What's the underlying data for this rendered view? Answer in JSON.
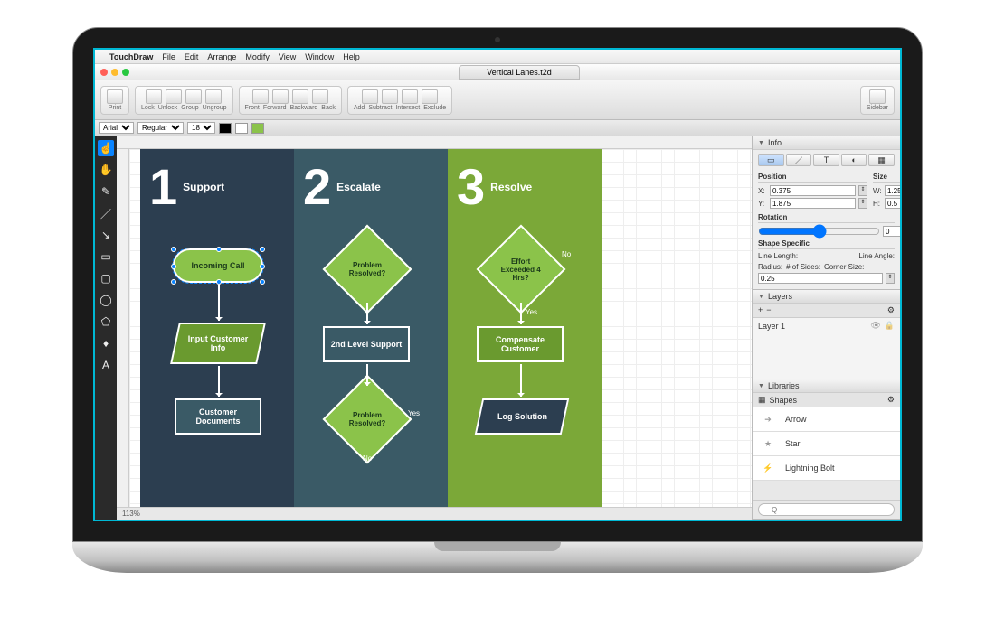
{
  "menubar": {
    "app": "TouchDraw",
    "items": [
      "File",
      "Edit",
      "Arrange",
      "Modify",
      "View",
      "Window",
      "Help"
    ]
  },
  "document": {
    "title": "Vertical Lanes.t2d"
  },
  "toolbar": {
    "print": "Print",
    "lock": "Lock",
    "unlock": "Unlock",
    "group": "Group",
    "ungroup": "Ungroup",
    "front": "Front",
    "forward": "Forward",
    "backward": "Backward",
    "back": "Back",
    "add": "Add",
    "subtract": "Subtract",
    "intersect": "Intersect",
    "exclude": "Exclude",
    "sidebar": "Sidebar"
  },
  "formatbar": {
    "font": "Arial",
    "weight": "Regular",
    "size": "18"
  },
  "status": {
    "zoom": "113%"
  },
  "lanes": [
    {
      "num": "1",
      "title": "Support"
    },
    {
      "num": "2",
      "title": "Escalate"
    },
    {
      "num": "3",
      "title": "Resolve"
    }
  ],
  "nodes": {
    "incoming": "Incoming Call",
    "problem1": "Problem Resolved?",
    "effort": "Effort Exceeded 4 Hrs?",
    "input": "Input Customer Info",
    "support2": "2nd Level Support",
    "compensate": "Compensate Customer",
    "docs": "Customer Documents",
    "problem2": "Problem Resolved?",
    "log": "Log Solution"
  },
  "edges": {
    "yes": "Yes",
    "no": "No"
  },
  "info": {
    "title": "Info",
    "pos": "Position",
    "size": "Size",
    "x": "0.375",
    "y": "1.875",
    "w": "1.25",
    "h": "0.5",
    "rotation_label": "Rotation",
    "rotation": "0",
    "shape_specific": "Shape Specific",
    "linelen": "Line Length:",
    "lineang": "Line Angle:",
    "radius": "Radius:",
    "sides": "# of Sides:",
    "corner": "Corner Size:",
    "corner_val": "0.25"
  },
  "layers": {
    "title": "Layers",
    "layer1": "Layer 1"
  },
  "libraries": {
    "title": "Libraries",
    "shapes": "Shapes",
    "items": [
      "Arrow",
      "Star",
      "Lightning Bolt"
    ]
  },
  "search": {
    "placeholder": "Q"
  }
}
